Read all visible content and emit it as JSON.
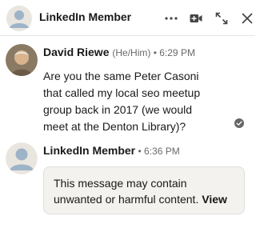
{
  "header": {
    "title": "LinkedIn Member",
    "icons": [
      "more-icon",
      "video-call-icon",
      "expand-icon",
      "close-icon"
    ]
  },
  "messages": [
    {
      "sender": "David Riewe",
      "pronouns": "(He/Him)",
      "separator": " • ",
      "time": "6:29 PM",
      "lines": [
        "Are you the same Peter Casoni",
        "that called my local seo meetup",
        "group back in 2017 (we would",
        "meet at the Denton Library)?"
      ]
    },
    {
      "sender": "LinkedIn Member",
      "separator": " • ",
      "time": "6:36 PM",
      "warning_text": "This message may contain unwanted or harmful content.",
      "warning_link": "View"
    }
  ],
  "colors": {
    "ghost_avatar_bg": "#e9e5df",
    "ghost_avatar_fg": "#9db3c8",
    "warning_bg": "#f3f2ef"
  }
}
